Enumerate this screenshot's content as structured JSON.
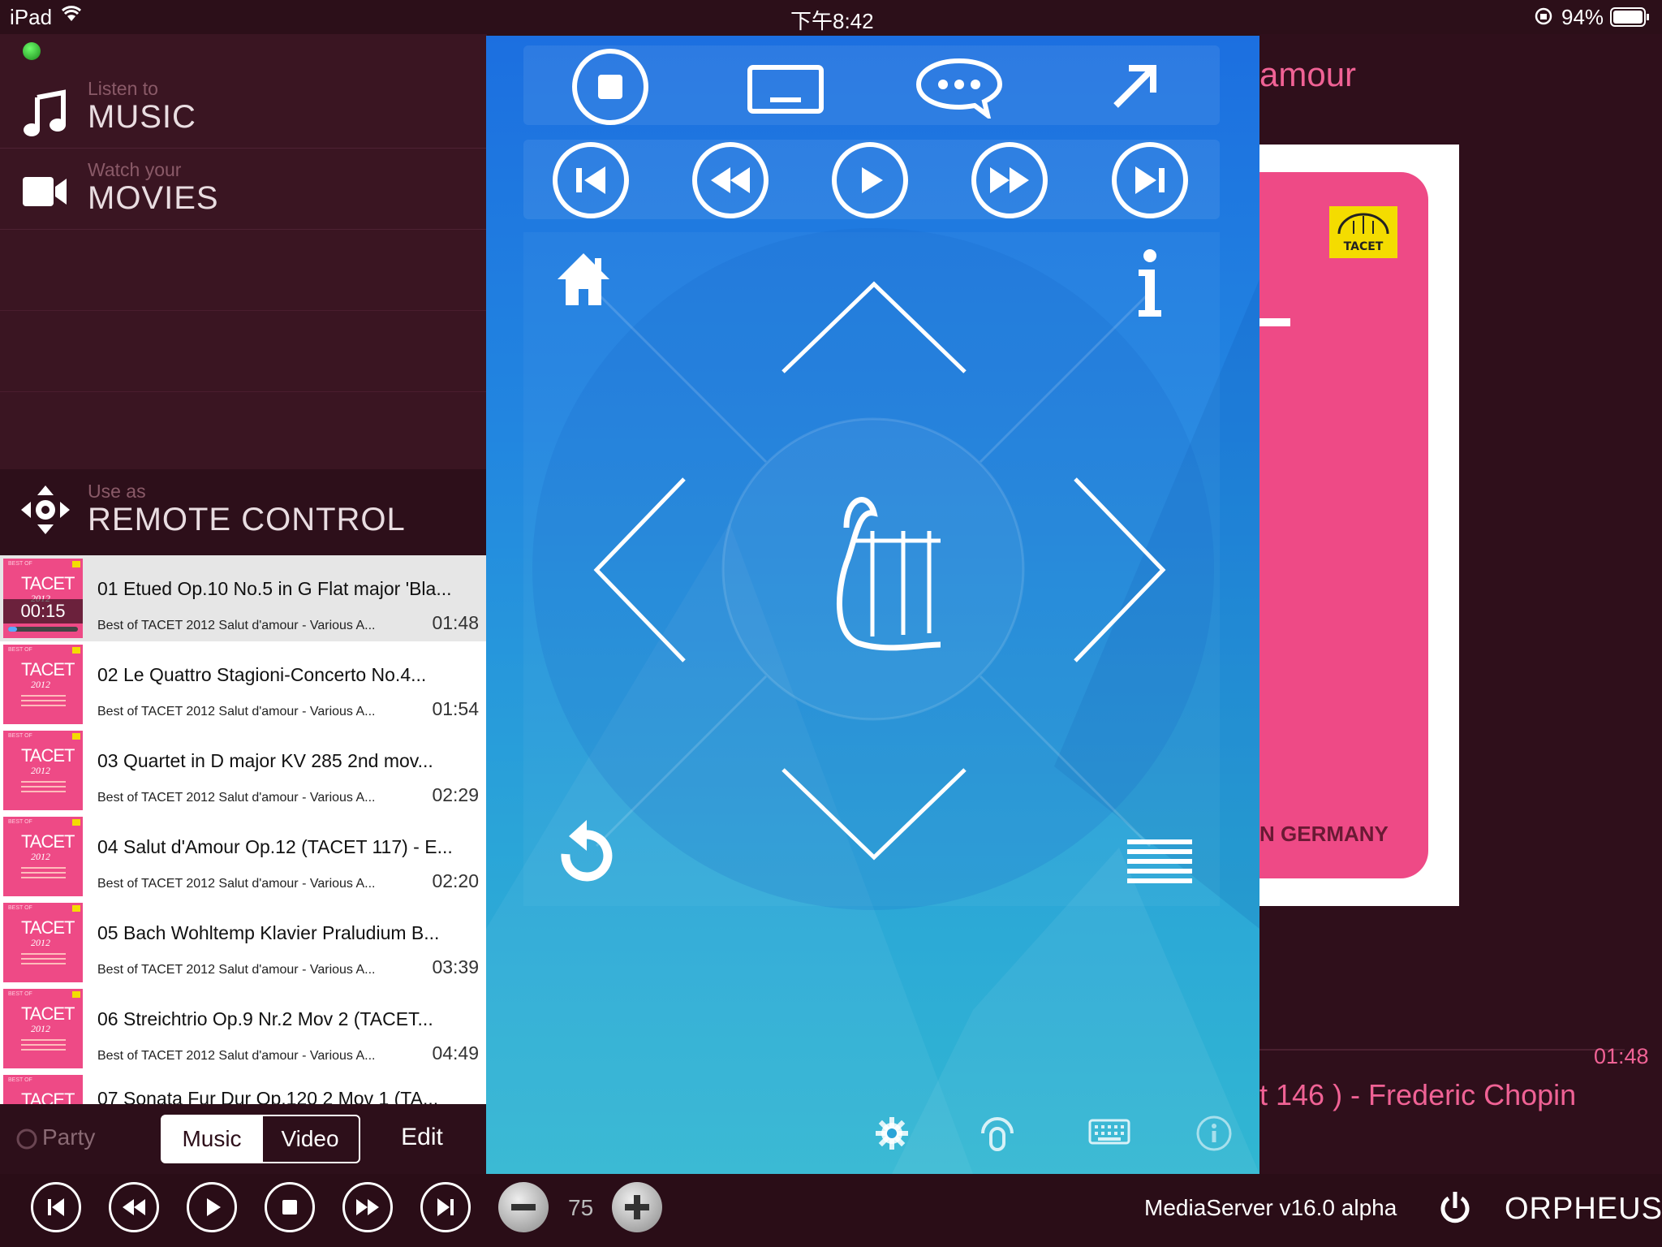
{
  "status_bar": {
    "device": "iPad",
    "time": "下午8:42",
    "battery": "94%"
  },
  "menu": {
    "music": {
      "sub": "Listen to",
      "main": "MUSIC",
      "icon": "music-note-icon"
    },
    "movies": {
      "sub": "Watch your",
      "main": "MOVIES",
      "icon": "video-camera-icon"
    },
    "remote": {
      "sub": "Use as",
      "main": "REMOTE CONTROL",
      "icon": "dpad-move-icon"
    }
  },
  "playlist": {
    "now_playing_elapsed": "00:15",
    "now_playing_progress": 0.125,
    "thumb_labels": {
      "top": "BEST OF",
      "brand": "TACET",
      "year": "2012"
    },
    "tracks": [
      {
        "title": "01 Etued Op.10 No.5 in G Flat major 'Bla...",
        "sub": "Best of TACET 2012 Salut d'amour - Various A...",
        "duration": "01:48"
      },
      {
        "title": "02 Le Quattro Stagioni-Concerto No.4...",
        "sub": "Best of TACET 2012 Salut d'amour - Various A...",
        "duration": "01:54"
      },
      {
        "title": "03 Quartet in D major KV 285 2nd mov...",
        "sub": "Best of TACET 2012 Salut d'amour - Various A...",
        "duration": "02:29"
      },
      {
        "title": "04 Salut d'Amour Op.12 (TACET 117) - E...",
        "sub": "Best of TACET 2012 Salut d'amour - Various A...",
        "duration": "02:20"
      },
      {
        "title": "05 Bach Wohltemp Klavier Praludium B...",
        "sub": "Best of TACET 2012 Salut d'amour - Various A...",
        "duration": "03:39"
      },
      {
        "title": "06 Streichtrio Op.9 Nr.2 Mov 2 (TACET...",
        "sub": "Best of TACET 2012 Salut d'amour - Various A...",
        "duration": "04:49"
      },
      {
        "title": "07 Sonata Fur Dur Op.120 2 Mov 1 (TA...",
        "sub": "",
        "duration": ""
      }
    ]
  },
  "segment_bar": {
    "party": "Party",
    "music": "Music",
    "video": "Video",
    "edit": "Edit"
  },
  "background_view": {
    "album_title_fragment": "amour",
    "album_text": "N GERMANY",
    "track_fragment": "t 146 ) - Frederic Chopin",
    "duration": "01:48"
  },
  "remote": {
    "top_row": [
      "stop-icon",
      "subtitle-icon",
      "chat-bubble-icon",
      "expand-icon"
    ],
    "transport_row": [
      "skip-previous-icon",
      "rewind-icon",
      "play-icon",
      "fast-forward-icon",
      "skip-next-icon"
    ],
    "bottom_row": [
      "settings-icon",
      "touch-icon",
      "keyboard-icon",
      "info-circle-icon"
    ]
  },
  "bottom_bar": {
    "volume": "75",
    "server": "MediaServer v16.0 alpha",
    "brand": "ORPHEUS"
  },
  "colors": {
    "accent_pink": "#ee4a86",
    "remote_blue": "#1c6fe0",
    "dark_bg": "#2a0d17"
  }
}
